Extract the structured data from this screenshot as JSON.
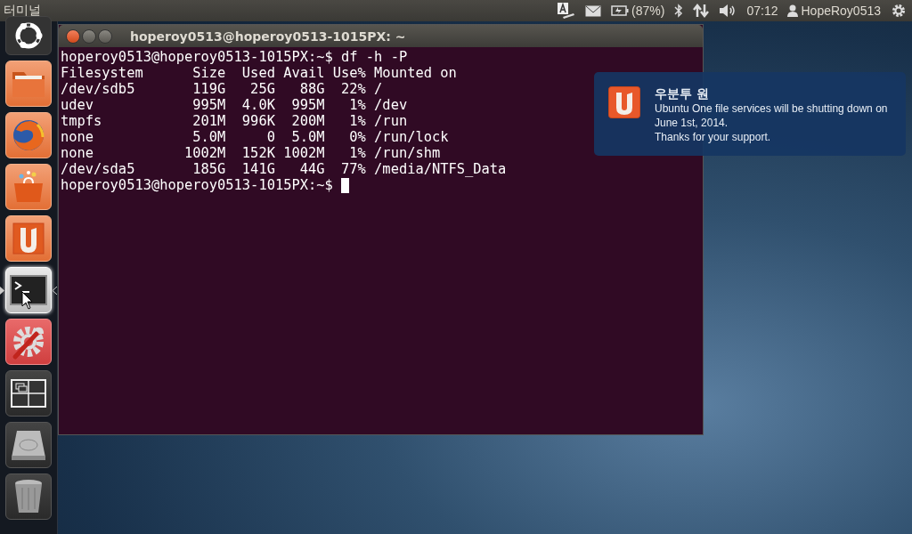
{
  "top_panel": {
    "app_title": "터미널",
    "indicators": [
      {
        "kind": "keyboard"
      },
      {
        "kind": "mail"
      },
      {
        "kind": "battery",
        "label": "(87%)"
      },
      {
        "kind": "bluetooth"
      },
      {
        "kind": "network"
      },
      {
        "kind": "volume"
      },
      {
        "kind": "clock",
        "label": "07:12"
      },
      {
        "kind": "user",
        "label": "HopeRoy0513"
      },
      {
        "kind": "gear"
      }
    ]
  },
  "launcher": {
    "items": [
      {
        "kind": "dash",
        "selected": false
      },
      {
        "kind": "files",
        "selected": false
      },
      {
        "kind": "firefox",
        "selected": false
      },
      {
        "kind": "software",
        "selected": false
      },
      {
        "kind": "ubuntuone",
        "selected": false
      },
      {
        "kind": "terminal",
        "selected": true
      },
      {
        "kind": "settings",
        "selected": false
      },
      {
        "kind": "workspaces",
        "selected": false
      },
      {
        "kind": "disk",
        "selected": false
      },
      {
        "kind": "trash",
        "selected": false
      }
    ]
  },
  "terminal_window": {
    "title": "hoperoy0513@hoperoy0513-1015PX: ~",
    "lines": [
      "hoperoy0513@hoperoy0513-1015PX:~$ df -h -P",
      "Filesystem      Size  Used Avail Use% Mounted on",
      "/dev/sdb5       119G   25G   88G  22% /",
      "udev            995M  4.0K  995M   1% /dev",
      "tmpfs           201M  996K  200M   1% /run",
      "none            5.0M     0  5.0M   0% /run/lock",
      "none           1002M  152K 1002M   1% /run/shm",
      "/dev/sda5       185G  141G   44G  77% /media/NTFS_Data",
      "hoperoy0513@hoperoy0513-1015PX:~$ "
    ]
  },
  "notification": {
    "title": "우분투 원",
    "body": [
      "Ubuntu One file services will be shutting down on June 1st, 2014.",
      "Thanks for your support."
    ]
  }
}
